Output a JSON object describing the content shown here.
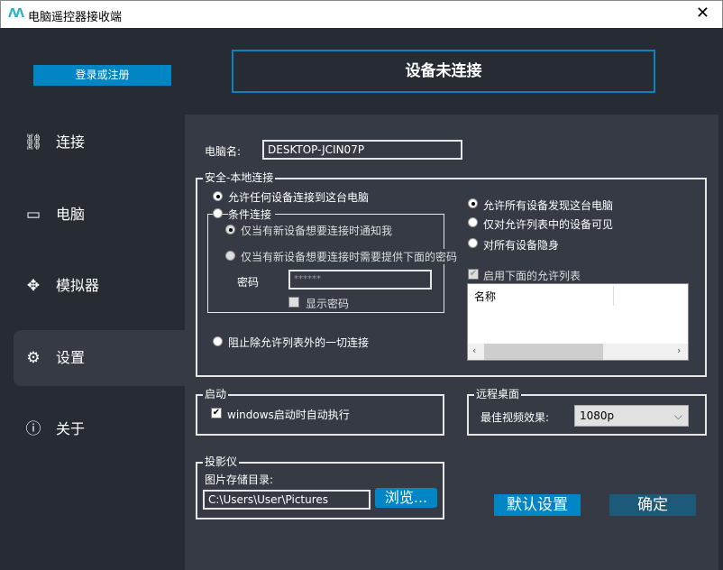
{
  "window": {
    "title": "电脑遥控器接收端",
    "close": "✕"
  },
  "login_label": "登录或注册",
  "status": "设备未连接",
  "sidebar": {
    "items": [
      {
        "label": "连接",
        "icon": "⛓"
      },
      {
        "label": "电脑",
        "icon": "▭"
      },
      {
        "label": "模拟器",
        "icon": "✥"
      },
      {
        "label": "设置",
        "icon": "⚙"
      },
      {
        "label": "关于",
        "icon": "ⓘ"
      }
    ]
  },
  "computer_name": {
    "label": "电脑名:",
    "value": "DESKTOP-JCIN07P"
  },
  "security": {
    "legend": "安全-本地连接",
    "allow_any": "允许任何设备连接到这台电脑",
    "conditional": "条件连接",
    "notify": "仅当有新设备想要连接时通知我",
    "require_password": "仅当有新设备想要连接时需要提供下面的密码",
    "password_label": "密码",
    "password_placeholder": "******",
    "show_password": "显示密码",
    "block_all": "阻止除允许列表外的一切连接",
    "discover_all": "允许所有设备发现这台电脑",
    "visible_list": "仅对允许列表中的设备可见",
    "hidden": "对所有设备隐身",
    "enable_list": "启用下面的允许列表",
    "list_column": "名称"
  },
  "startup": {
    "legend": "启动",
    "autorun": "windows启动时自动执行"
  },
  "remote": {
    "legend": "远程桌面",
    "quality_label": "最佳视频效果:",
    "quality_value": "1080p"
  },
  "projector": {
    "legend": "投影仪",
    "dir_label": "图片存储目录:",
    "dir_value": "C:\\Users\\User\\Pictures",
    "browse": "浏览..."
  },
  "buttons": {
    "defaults": "默认设置",
    "ok": "确定"
  },
  "colors": {
    "accent": "#0086c4",
    "ok_button": "#1d5a7a"
  }
}
